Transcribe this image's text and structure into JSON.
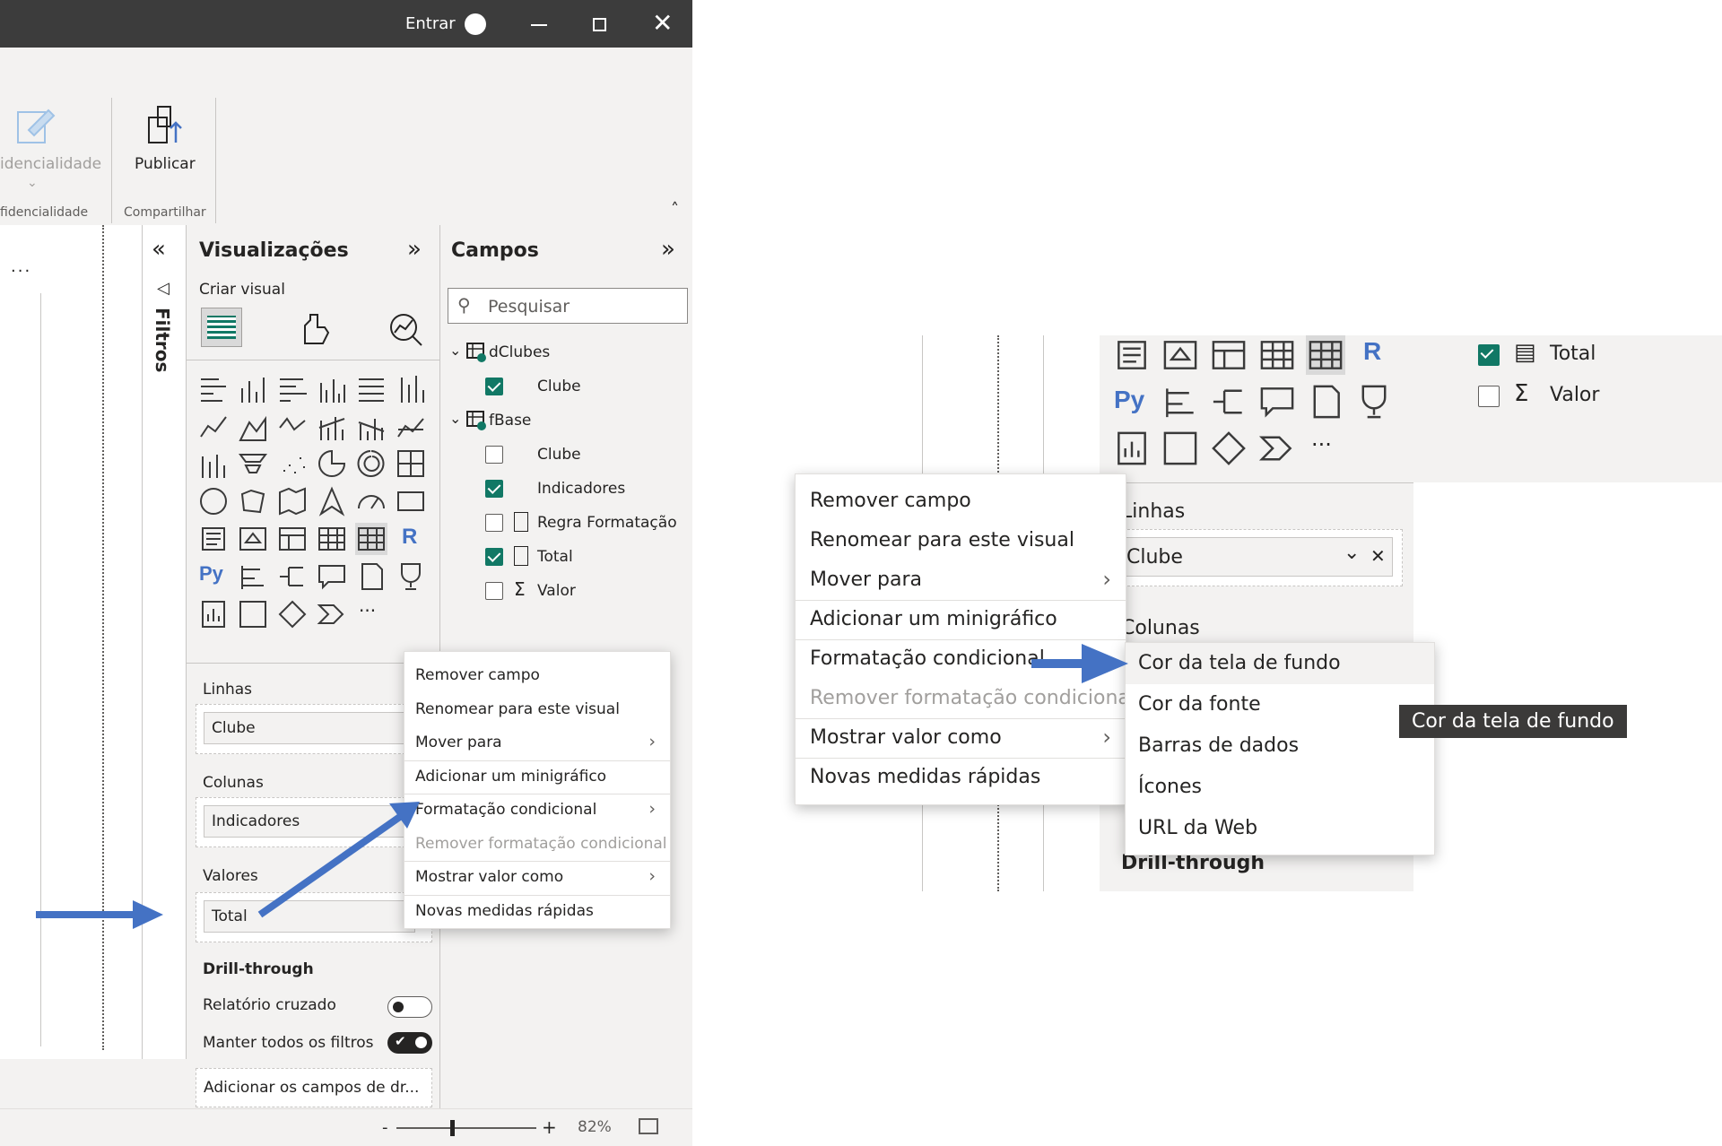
{
  "titlebar": {
    "signin": "Entrar"
  },
  "ribbon": {
    "sensitivity_label": "idencialidade",
    "sensitivity_group": "fidencialidade",
    "publish_label": "Publicar",
    "share_group": "Compartilhar"
  },
  "canvas": {
    "more": "..."
  },
  "filters": {
    "label": "Filtros"
  },
  "viz": {
    "title": "Visualizações",
    "build_visual": "Criar visual",
    "wells": {
      "rows_label": "Linhas",
      "rows_value": "Clube",
      "cols_label": "Colunas",
      "cols_value": "Indicadores",
      "values_label": "Valores",
      "values_value": "Total"
    },
    "drill": {
      "title": "Drill-through",
      "cross_report": "Relatório cruzado",
      "keep_filters": "Manter todos os filtros",
      "add_fields": "Adicionar os campos de dr..."
    }
  },
  "fields": {
    "title": "Campos",
    "search_placeholder": "Pesquisar",
    "tables": [
      {
        "name": "dClubes",
        "items": [
          {
            "label": "Clube",
            "checked": true
          }
        ]
      },
      {
        "name": "fBase",
        "items": [
          {
            "label": "Clube",
            "checked": false
          },
          {
            "label": "Indicadores",
            "checked": true
          },
          {
            "label": "Regra Formatação",
            "checked": false
          },
          {
            "label": "Total",
            "checked": true
          },
          {
            "label": "Valor",
            "checked": false
          }
        ]
      }
    ]
  },
  "context_menu": {
    "items": [
      "Remover campo",
      "Renomear para este visual",
      "Mover para",
      "Adicionar um minigráfico",
      "Formatação condicional",
      "Remover formatação condicional",
      "Mostrar valor como",
      "Novas medidas rápidas"
    ]
  },
  "statusbar": {
    "zoom_minus": "-",
    "zoom_plus": "+",
    "zoom": "82%"
  },
  "zoomed": {
    "fields": [
      {
        "label": "Total",
        "checked": true
      },
      {
        "label": "Valor",
        "checked": false
      }
    ],
    "rows_label": "Linhas",
    "rows_value": "Clube",
    "cols_label": "Colunas",
    "drill_title": "Drill-through",
    "submenu": [
      "Cor da tela de fundo",
      "Cor da fonte",
      "Barras de dados",
      "Ícones",
      "URL da Web"
    ],
    "tooltip": "Cor da tela de fundo"
  },
  "colors": {
    "accent": "#4472c4",
    "check": "#117865",
    "titlebar": "#3c3c3c"
  }
}
